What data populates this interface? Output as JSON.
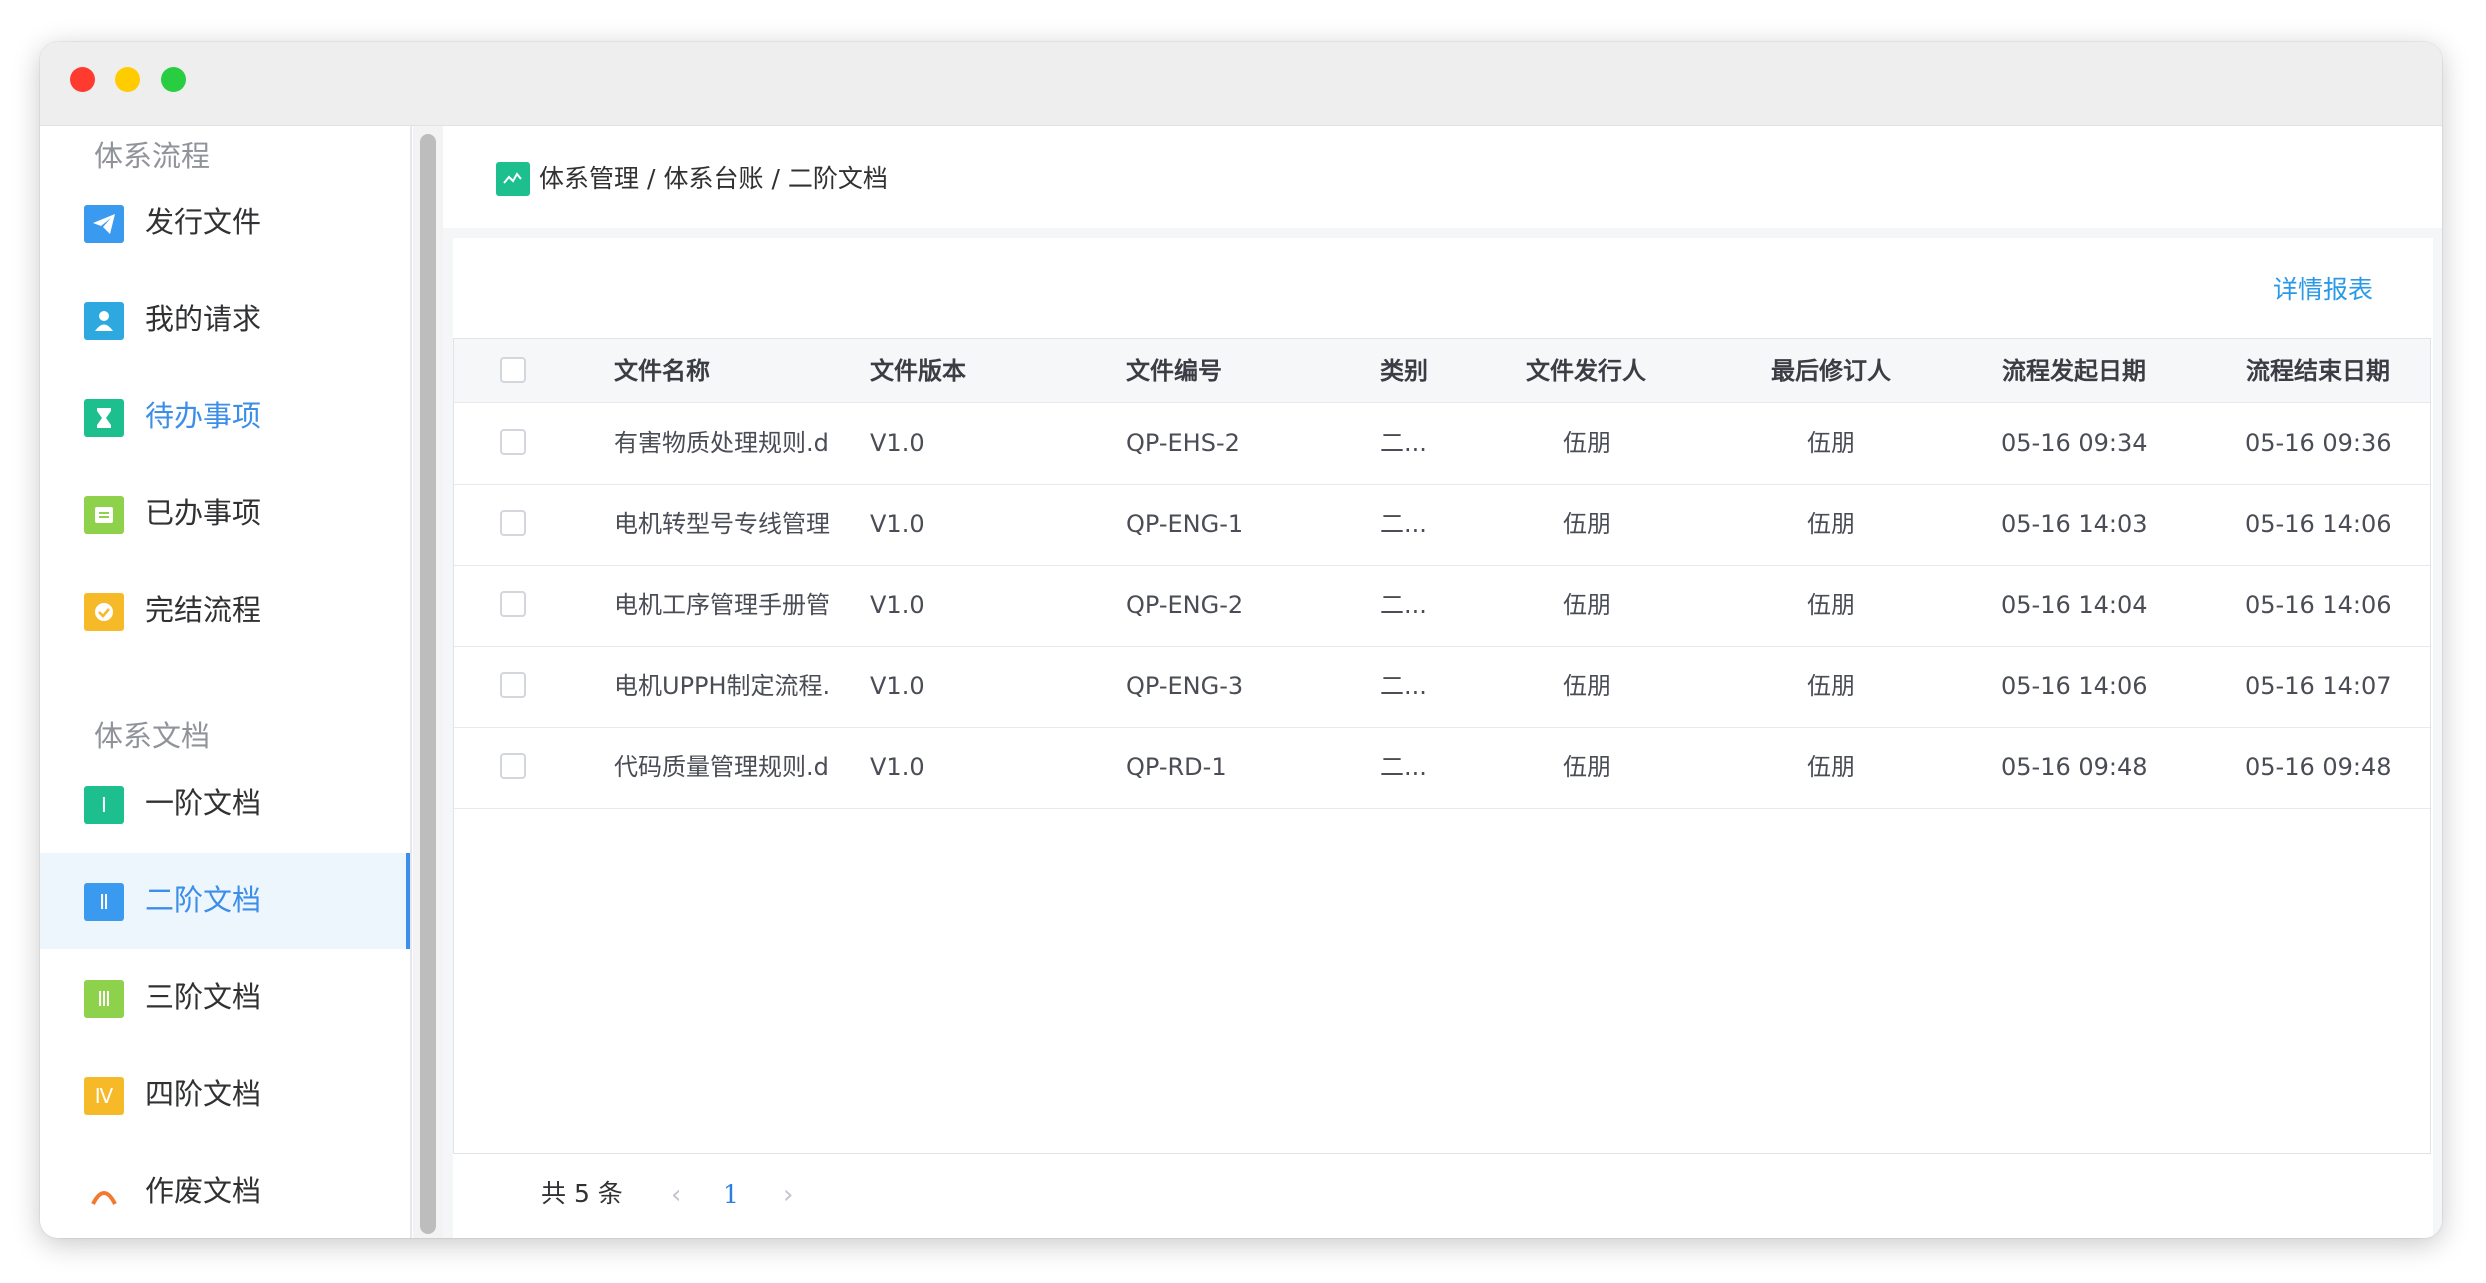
{
  "sidebar": {
    "section1": "体系流程",
    "section2": "体系文档",
    "items": [
      {
        "label": "发行文件",
        "icon": "paper-plane-icon",
        "color": "#3a9af0"
      },
      {
        "label": "我的请求",
        "icon": "user-icon",
        "color": "#2ea9e0"
      },
      {
        "label": "待办事项",
        "icon": "hourglass-icon",
        "color": "#1dbf8e"
      },
      {
        "label": "已办事项",
        "icon": "document-icon",
        "color": "#8ed14a"
      },
      {
        "label": "完结流程",
        "icon": "check-circle-icon",
        "color": "#f6b928"
      },
      {
        "label": "一阶文档",
        "icon": "roman-one-icon",
        "glyph": "Ⅰ",
        "color": "#1dbf8e"
      },
      {
        "label": "二阶文档",
        "icon": "roman-two-icon",
        "glyph": "Ⅱ",
        "color": "#3a9af0"
      },
      {
        "label": "三阶文档",
        "icon": "roman-three-icon",
        "glyph": "Ⅲ",
        "color": "#8ed14a"
      },
      {
        "label": "四阶文档",
        "icon": "roman-four-icon",
        "glyph": "Ⅳ",
        "color": "#f6b928"
      },
      {
        "label": "作废文档",
        "icon": "void-icon",
        "color": "#f27a30"
      }
    ]
  },
  "breadcrumb": {
    "items": [
      "体系管理",
      "/",
      "体系台账",
      "/",
      "二阶文档"
    ]
  },
  "report_link": "详情报表",
  "table": {
    "columns": [
      "文件名称",
      "文件版本",
      "文件编号",
      "类别",
      "文件发行人",
      "最后修订人",
      "流程发起日期",
      "流程结束日期"
    ],
    "rows": [
      [
        "有害物质处理规则.d",
        "V1.0",
        "QP-EHS-2",
        "二...",
        "伍朋",
        "伍朋",
        "05-16 09:34",
        "05-16 09:36"
      ],
      [
        "电机转型号专线管理",
        "V1.0",
        "QP-ENG-1",
        "二...",
        "伍朋",
        "伍朋",
        "05-16 14:03",
        "05-16 14:06"
      ],
      [
        "电机工序管理手册管",
        "V1.0",
        "QP-ENG-2",
        "二...",
        "伍朋",
        "伍朋",
        "05-16 14:04",
        "05-16 14:06"
      ],
      [
        "电机UPPH制定流程.",
        "V1.0",
        "QP-ENG-3",
        "二...",
        "伍朋",
        "伍朋",
        "05-16 14:06",
        "05-16 14:07"
      ],
      [
        "代码质量管理规则.d",
        "V1.0",
        "QP-RD-1",
        "二...",
        "伍朋",
        "伍朋",
        "05-16 09:48",
        "05-16 09:48"
      ]
    ]
  },
  "pagination": {
    "total": "共 5 条",
    "prev": "‹",
    "page": "1",
    "next": "›"
  }
}
